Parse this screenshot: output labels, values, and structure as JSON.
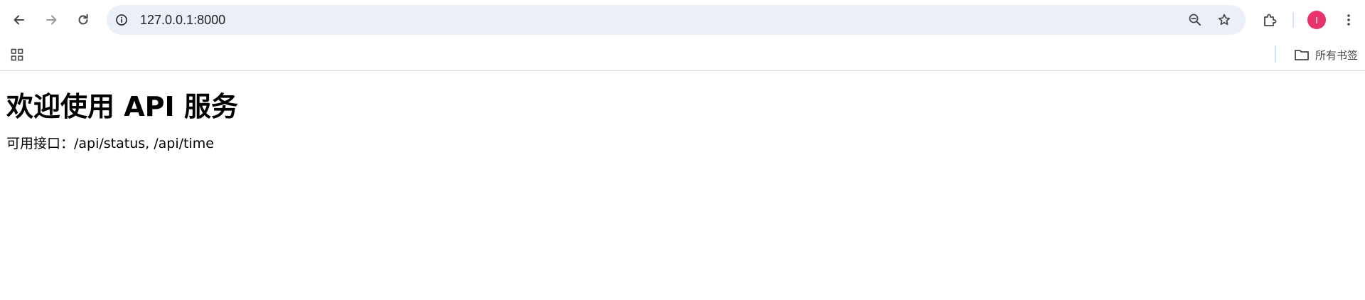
{
  "browser": {
    "address_bar": {
      "url": "127.0.0.1:8000"
    },
    "profile": {
      "initial": "I",
      "color": "#e8336b"
    },
    "bookmarks_bar": {
      "all_bookmarks_label": "所有书签"
    },
    "icons": {
      "back": "arrow-left-icon",
      "forward": "arrow-right-icon",
      "reload": "reload-icon",
      "site_info": "info-icon",
      "zoom": "zoom-out-icon",
      "bookmark": "star-icon",
      "extensions": "puzzle-icon",
      "menu": "kebab-menu-icon",
      "apps": "apps-grid-icon",
      "folder": "folder-icon"
    }
  },
  "page": {
    "heading": "欢迎使用 API 服务",
    "description": "可用接口：/api/status, /api/time"
  }
}
